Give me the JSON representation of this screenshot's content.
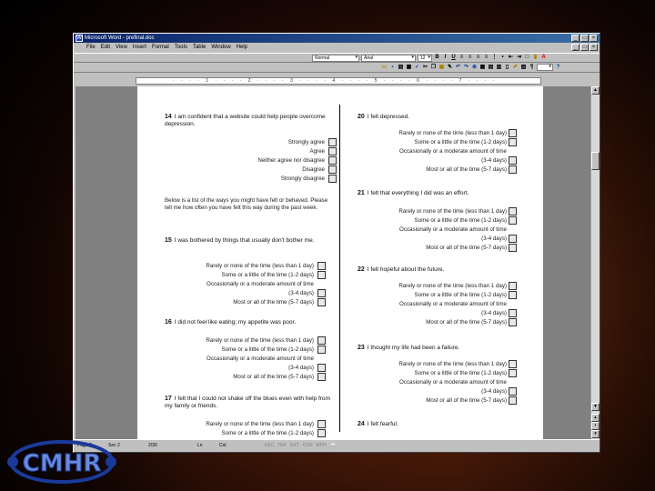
{
  "window": {
    "title": "Microsoft Word - prefinal.doc",
    "menus": [
      "File",
      "Edit",
      "View",
      "Insert",
      "Format",
      "Tools",
      "Table",
      "Window",
      "Help"
    ],
    "style_value": "Normal",
    "font_value": "Arial",
    "size_value": "12"
  },
  "column_left": {
    "q14": {
      "num": "14",
      "text": "I am confident that a website could help people overcome depression.",
      "options": [
        "Strongly agree",
        "Agree",
        "Neither agree nor disagree",
        "Disagree",
        "Strongly disagree"
      ]
    },
    "instructions": "Below is a list of the ways you might have felt or behaved. Please tell me how often you have felt this way during the past week.",
    "q15": {
      "num": "15",
      "text": "I was bothered by things that usually don't bother me."
    },
    "q16": {
      "num": "16",
      "text": "I did not feel like eating; my appetite was poor."
    },
    "q17": {
      "num": "17",
      "text": "I felt that I could not shake off the blues even with help from my family or friends."
    }
  },
  "column_right": {
    "q20": {
      "num": "20",
      "text": "I felt depressed."
    },
    "q21": {
      "num": "21",
      "text": "I felt that everything I did was an effort."
    },
    "q22": {
      "num": "22",
      "text": "I felt hopeful about the future."
    },
    "q23": {
      "num": "23",
      "text": "I thought my life had been a failure."
    },
    "q24": {
      "num": "24",
      "text": "I felt fearful."
    }
  },
  "freq": {
    "rarely": "Rarely or none of the time (less than 1 day)",
    "some": "Some or a little of the time (1-2 days)",
    "occ": "Occasionally or a moderate amount of time",
    "occ2": "(3-4 days)",
    "most": "Most or all of the time (5-7 days)"
  },
  "status": {
    "page": "Page 2",
    "sec": "Sec 2",
    "pos": "2/30",
    "ln": "Ln",
    "col": "Col",
    "modes": [
      "REC",
      "TRK",
      "EXT",
      "OVR",
      "WPH"
    ]
  },
  "logo": {
    "text": "CMHR"
  },
  "colors": {
    "accent": "#0a246a",
    "logo_blue": "#1a3a9a"
  }
}
